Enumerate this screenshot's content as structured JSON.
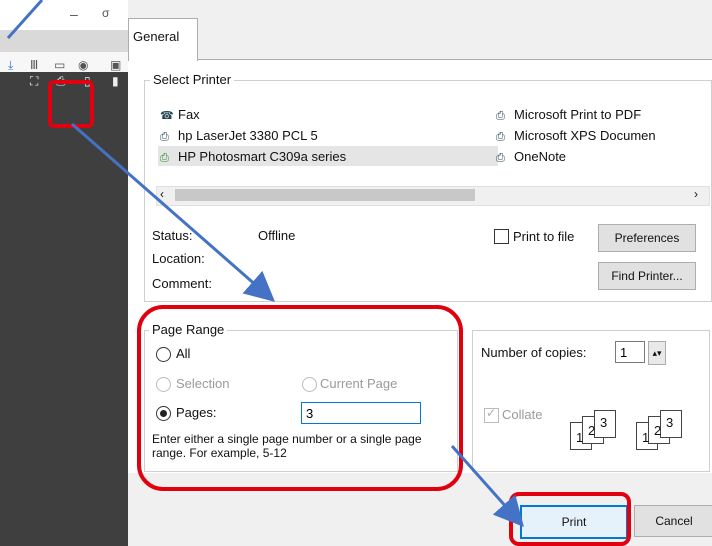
{
  "browser": {
    "window_minimize_icon": "minimize-icon",
    "window_maximize_icon": "maximize-icon",
    "toolbar_icons": [
      "download-icon",
      "library-icon",
      "reader-icon",
      "extensions-icon",
      "menu-icon"
    ],
    "sidebar_icons": [
      "fullscreen-icon",
      "print-icon",
      "sidebar-icon",
      "bookmark-icon"
    ]
  },
  "dialog": {
    "tab_label": "General",
    "select_printer": {
      "legend": "Select Printer",
      "printers": [
        {
          "name": "Fax",
          "icon": "fax-icon"
        },
        {
          "name": "hp LaserJet 3380 PCL 5",
          "icon": "printer-icon"
        },
        {
          "name": "HP Photosmart C309a series",
          "icon": "printer-icon",
          "selected": true
        },
        {
          "name": "Microsoft Print to PDF",
          "icon": "printer-icon"
        },
        {
          "name": "Microsoft XPS Documen",
          "icon": "printer-icon"
        },
        {
          "name": "OneNote",
          "icon": "printer-icon"
        }
      ],
      "status_label": "Status:",
      "status_value": "Offline",
      "location_label": "Location:",
      "comment_label": "Comment:",
      "print_to_file_label": "Print to file",
      "preferences_button": "Preferences",
      "find_printer_button": "Find Printer..."
    },
    "page_range": {
      "legend": "Page Range",
      "all_label": "All",
      "selection_label": "Selection",
      "current_page_label": "Current Page",
      "pages_label": "Pages:",
      "pages_value": "3",
      "hint": "Enter either a single page number or a single page range.  For example, 5-12"
    },
    "copies": {
      "label": "Number of copies:",
      "value": "1",
      "collate_label": "Collate",
      "page_digits": [
        "1",
        "2",
        "3"
      ]
    },
    "print_button": "Print",
    "cancel_button": "Cancel"
  },
  "colors": {
    "highlight": "#e1000f",
    "arrow": "#4472c4",
    "selected_row": "#cce8ff"
  }
}
